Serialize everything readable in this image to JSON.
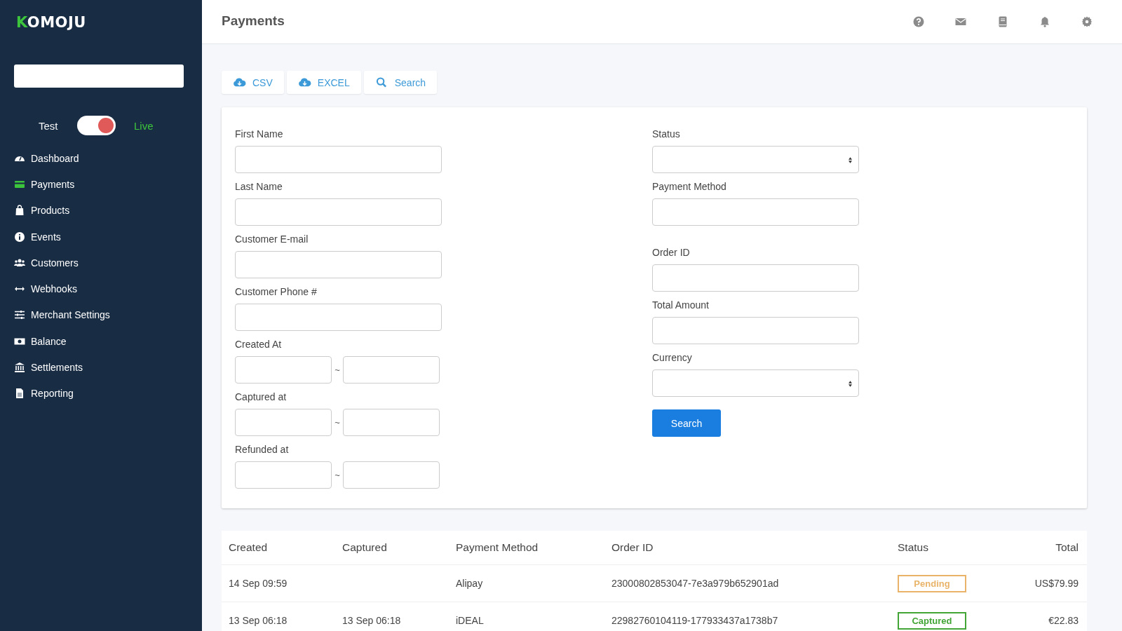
{
  "sidebar": {
    "logo": "KOMOJU",
    "mode": {
      "left_label": "Test",
      "right_label": "Live",
      "on": true
    },
    "items": [
      {
        "label": "Dashboard",
        "kind": "gauge",
        "selected": false
      },
      {
        "label": "Payments",
        "kind": "card",
        "selected": true
      },
      {
        "label": "Products",
        "kind": "bag",
        "selected": false
      },
      {
        "label": "Events",
        "kind": "info",
        "selected": false
      },
      {
        "label": "Customers",
        "kind": "users",
        "selected": false
      },
      {
        "label": "Webhooks",
        "kind": "arrows",
        "selected": false
      },
      {
        "label": "Merchant Settings",
        "kind": "sliders",
        "selected": false
      },
      {
        "label": "Balance",
        "kind": "money",
        "selected": false
      },
      {
        "label": "Settlements",
        "kind": "bank",
        "selected": false
      },
      {
        "label": "Reporting",
        "kind": "file",
        "selected": false
      }
    ]
  },
  "header": {
    "title": "Payments"
  },
  "toolbar": [
    {
      "label": "CSV",
      "kind": "download"
    },
    {
      "label": "EXCEL",
      "kind": "download"
    },
    {
      "label": "Search",
      "kind": "search"
    }
  ],
  "form": {
    "left": [
      {
        "label": "First Name",
        "kind": "text"
      },
      {
        "label": "Last Name",
        "kind": "text"
      },
      {
        "label": "Customer E-mail",
        "kind": "text"
      },
      {
        "label": "Customer Phone #",
        "kind": "text"
      },
      {
        "label": "Created At",
        "kind": "range",
        "separator": "~"
      },
      {
        "label": "Captured at",
        "kind": "range",
        "separator": "~"
      },
      {
        "label": "Refunded at",
        "kind": "range",
        "separator": "~"
      }
    ],
    "right": [
      {
        "label": "Status",
        "kind": "select"
      },
      {
        "label": "Payment Method",
        "kind": "text"
      },
      {
        "label": "Order ID",
        "kind": "text"
      },
      {
        "label": "Total Amount",
        "kind": "text"
      },
      {
        "label": "Currency",
        "kind": "select"
      }
    ],
    "submit": "Search"
  },
  "table": {
    "columns": [
      "Created",
      "Captured",
      "Payment Method",
      "Order ID",
      "Status",
      "Total"
    ],
    "rows": [
      {
        "created": "14 Sep 09:59",
        "method": "Alipay",
        "order_id": "23000802853047-7e3a979b652901ad",
        "status": "Pending",
        "color": "#e9b46a",
        "total": "US$79.99"
      },
      {
        "created": "13 Sep 06:18",
        "captured": "13 Sep 06:18",
        "method": "iDEAL",
        "order_id": "22982760104119-177933437a1738b7",
        "status": "Captured",
        "color": "#43a536",
        "total": "€22.83"
      }
    ]
  }
}
